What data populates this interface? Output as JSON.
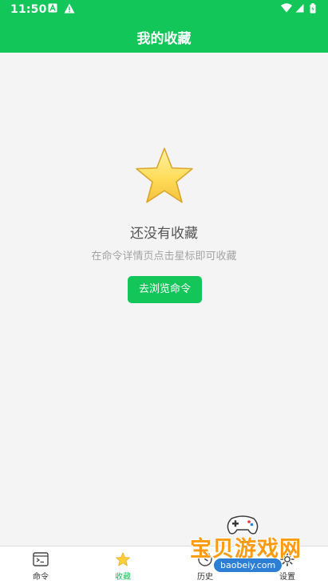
{
  "status_bar": {
    "time": "11:50",
    "icons": [
      "a-icon",
      "warning-icon",
      "wifi-icon",
      "signal-icon",
      "battery-icon"
    ]
  },
  "header": {
    "title": "我的收藏"
  },
  "empty_state": {
    "icon": "star-icon",
    "title": "还没有收藏",
    "hint": "在命令详情页点击星标即可收藏",
    "button_label": "去浏览命令"
  },
  "bottom_nav": {
    "items": [
      {
        "label": "命令",
        "icon": "terminal-icon",
        "active": false
      },
      {
        "label": "收藏",
        "icon": "star-icon",
        "active": true
      },
      {
        "label": "历史",
        "icon": "clock-icon",
        "active": false
      },
      {
        "label": "设置",
        "icon": "gear-icon",
        "active": false
      }
    ]
  },
  "watermark": {
    "text": "宝贝游戏网",
    "url": "baobeiy.com"
  },
  "colors": {
    "accent": "#12c65a",
    "background": "#f4f4f5",
    "star": "#ffd54f"
  }
}
